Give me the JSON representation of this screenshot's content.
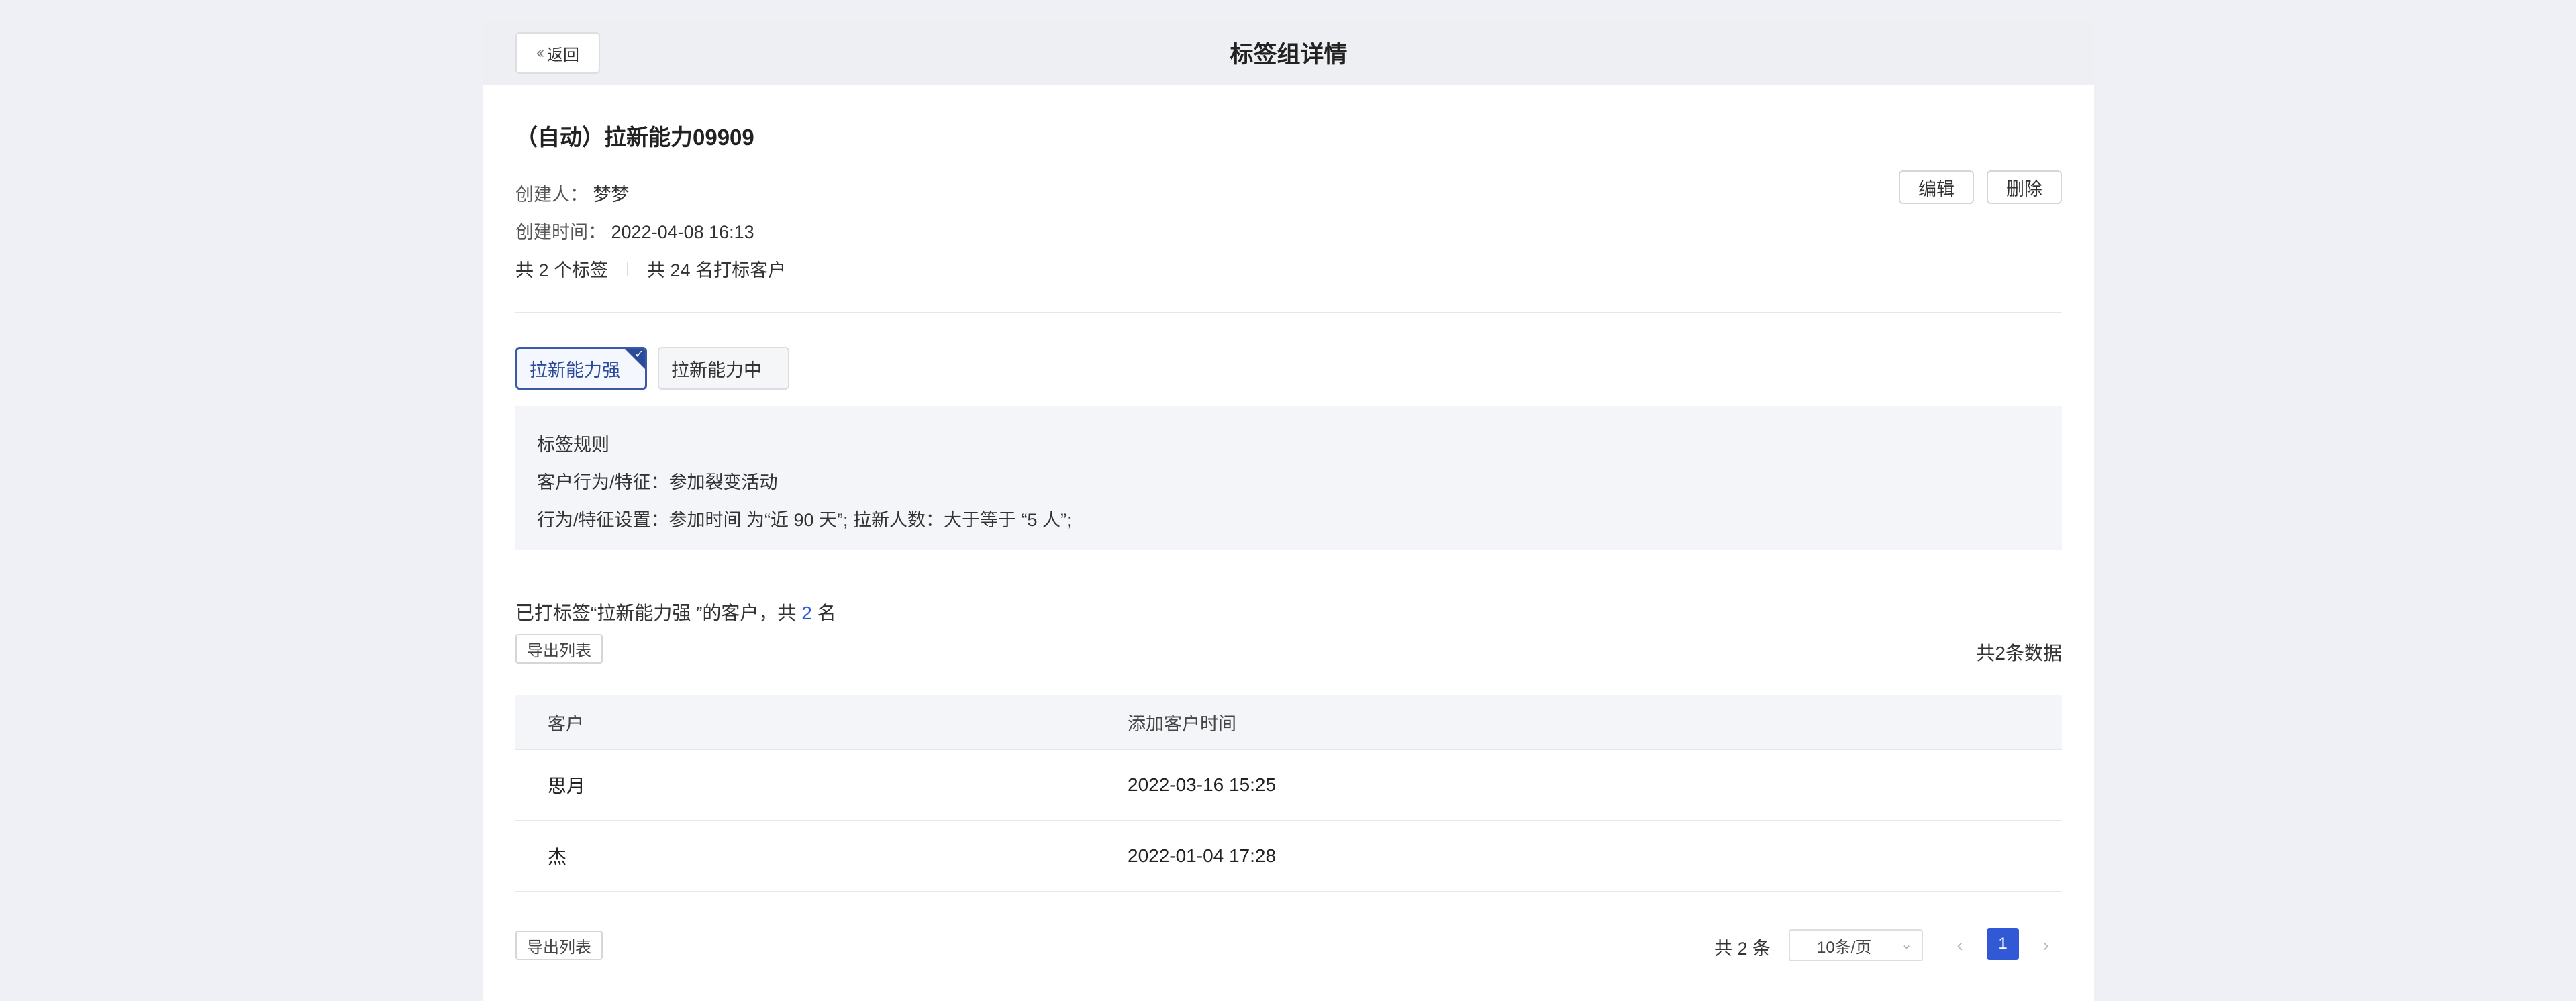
{
  "header": {
    "back_label": "返回",
    "title": "标签组详情"
  },
  "group": {
    "name": "（自动）拉新能力09909",
    "creator_label": "创建人：",
    "creator": "梦梦",
    "created_label": "创建时间：",
    "created_at": "2022-04-08 16:13",
    "tag_count": "共 2 个标签",
    "customer_count": "共 24 名打标客户",
    "edit_label": "编辑",
    "delete_label": "删除"
  },
  "tags": [
    {
      "label": "拉新能力强",
      "selected": true
    },
    {
      "label": "拉新能力中",
      "selected": false
    }
  ],
  "rule": {
    "title": "标签规则",
    "behavior": "客户行为/特征：参加裂变活动",
    "setting": "行为/特征设置：参加时间 为“近 90 天”; 拉新人数：大于等于 “5 人”;"
  },
  "summary": {
    "prefix": "已打标签“拉新能力强 ”的客户，共 ",
    "count": "2",
    "suffix": " 名"
  },
  "export_label": "导出列表",
  "total_data": "共2条数据",
  "table": {
    "columns": [
      "客户",
      "添加客户时间"
    ],
    "rows": [
      {
        "customer": "思月",
        "time": "2022-03-16 15:25"
      },
      {
        "customer": "杰",
        "time": "2022-01-04 17:28"
      }
    ]
  },
  "pagination": {
    "total": "共 2 条",
    "page_size": "10条/页",
    "current_page": "1"
  },
  "colors": {
    "accent": "#2b4a9a",
    "page_active": "#3159d6",
    "background": "#eef0f6"
  }
}
